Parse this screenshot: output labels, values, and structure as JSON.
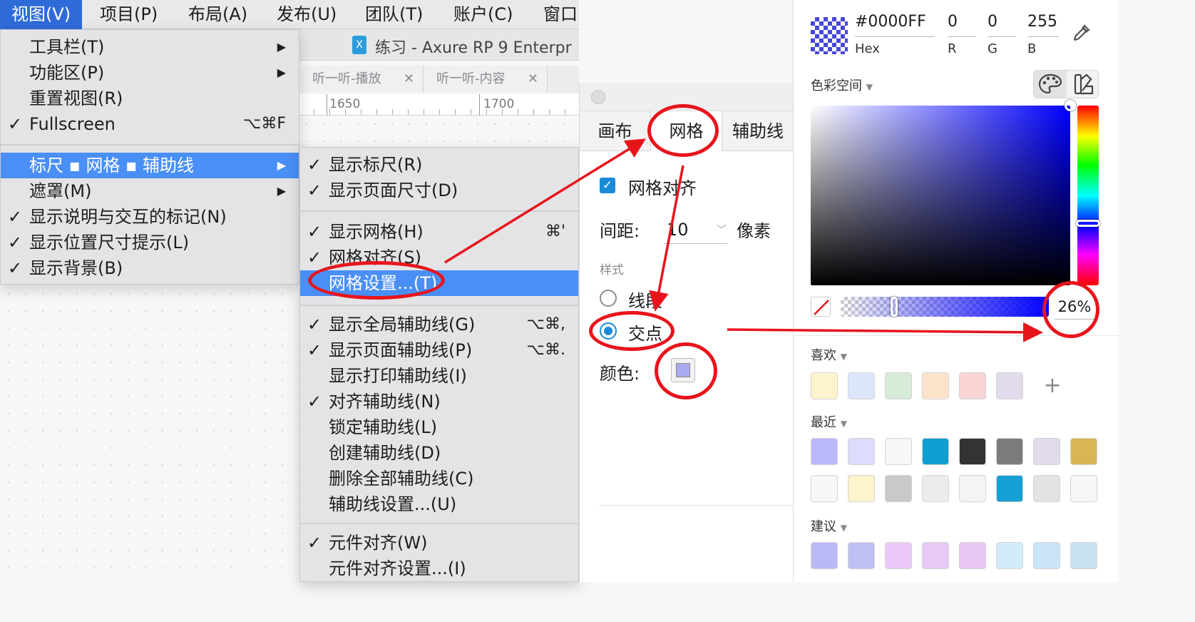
{
  "menubar": {
    "items": [
      "视图(V)",
      "项目(P)",
      "布局(A)",
      "发布(U)",
      "团队(T)",
      "账户(C)",
      "窗口"
    ]
  },
  "window": {
    "title": "练习 - Axure RP 9 Enterpr",
    "tabs": [
      "听一听-播放",
      "听一听-内容"
    ],
    "ruler_ticks": [
      "1650",
      "1700"
    ]
  },
  "view_menu": {
    "items": [
      {
        "check": "",
        "label": "工具栏(T)",
        "shortcut": "",
        "submenu": "▶"
      },
      {
        "check": "",
        "label": "功能区(P)",
        "shortcut": "",
        "submenu": "▶"
      },
      {
        "check": "",
        "label": "重置视图(R)",
        "shortcut": "",
        "submenu": ""
      },
      {
        "check": "✓",
        "label": "Fullscreen",
        "shortcut": "⌥⌘F",
        "submenu": ""
      },
      {
        "check": "",
        "label": "标尺 ▪ 网格 ▪ 辅助线",
        "shortcut": "",
        "submenu": "▶"
      },
      {
        "check": "",
        "label": "遮罩(M)",
        "shortcut": "",
        "submenu": "▶"
      },
      {
        "check": "✓",
        "label": "显示说明与交互的标记(N)",
        "shortcut": "",
        "submenu": ""
      },
      {
        "check": "✓",
        "label": "显示位置尺寸提示(L)",
        "shortcut": "",
        "submenu": ""
      },
      {
        "check": "✓",
        "label": "显示背景(B)",
        "shortcut": "",
        "submenu": ""
      }
    ]
  },
  "sub_menu": {
    "items": [
      {
        "check": "✓",
        "label": "显示标尺(R)",
        "shortcut": ""
      },
      {
        "check": "✓",
        "label": "显示页面尺寸(D)",
        "shortcut": ""
      },
      {
        "check": "✓",
        "label": "显示网格(H)",
        "shortcut": "⌘'"
      },
      {
        "check": "✓",
        "label": "网格对齐(S)",
        "shortcut": ""
      },
      {
        "check": "",
        "label": "网格设置...(T)",
        "shortcut": ""
      },
      {
        "check": "✓",
        "label": "显示全局辅助线(G)",
        "shortcut": "⌥⌘,"
      },
      {
        "check": "✓",
        "label": "显示页面辅助线(P)",
        "shortcut": "⌥⌘."
      },
      {
        "check": "",
        "label": "显示打印辅助线(I)",
        "shortcut": ""
      },
      {
        "check": "✓",
        "label": "对齐辅助线(N)",
        "shortcut": ""
      },
      {
        "check": "",
        "label": "锁定辅助线(L)",
        "shortcut": ""
      },
      {
        "check": "",
        "label": "创建辅助线(D)",
        "shortcut": ""
      },
      {
        "check": "",
        "label": "删除全部辅助线(C)",
        "shortcut": ""
      },
      {
        "check": "",
        "label": "辅助线设置...(U)",
        "shortcut": ""
      },
      {
        "check": "✓",
        "label": "元件对齐(W)",
        "shortcut": ""
      },
      {
        "check": "",
        "label": "元件对齐设置...(I)",
        "shortcut": ""
      }
    ]
  },
  "grid_dialog": {
    "tabs": [
      "画布",
      "网格",
      "辅助线"
    ],
    "snap_label": "网格对齐",
    "snap_checked": true,
    "spacing_label": "间距:",
    "spacing_value": "10",
    "spacing_unit": "像素",
    "style_header": "样式",
    "style_options": [
      "线段",
      "交点"
    ],
    "style_selected": "交点",
    "color_label": "颜色:",
    "color_value": "#aaaaf0"
  },
  "color_picker": {
    "hex": "#0000FF",
    "hex_label": "Hex",
    "r": "0",
    "r_label": "R",
    "g": "0",
    "g_label": "G",
    "b": "255",
    "b_label": "B",
    "color_space_label": "色彩空间",
    "opacity": "26%",
    "favorites_label": "喜欢",
    "favorites": [
      "#fdf3cc",
      "#dde7fb",
      "#d6ecd9",
      "#fde3cc",
      "#f9d4d5",
      "#e1dbec"
    ],
    "recent_label": "最近",
    "recent": [
      "#b9b9fa",
      "#dcdcfd",
      "#f7f7f7",
      "#0e9ecf",
      "#333333",
      "#7b7b7b",
      "#e1dbec",
      "#d8b655",
      "#f7f7f7",
      "#fdf3cc",
      "#c9c9c9",
      "#ececec",
      "#f4f4f4",
      "#159fd5",
      "#e3e3e3",
      "#f7f7f7"
    ],
    "suggest_label": "建议",
    "suggest": [
      "#b9b9f6",
      "#c0c0f2",
      "#ecc8f8",
      "#e6c9f4",
      "#e8c7f2",
      "#d2ecfb",
      "#cbe4f7",
      "#c9e2f3"
    ],
    "accent": "#0000FF"
  },
  "annotation_color": "#e8141c"
}
